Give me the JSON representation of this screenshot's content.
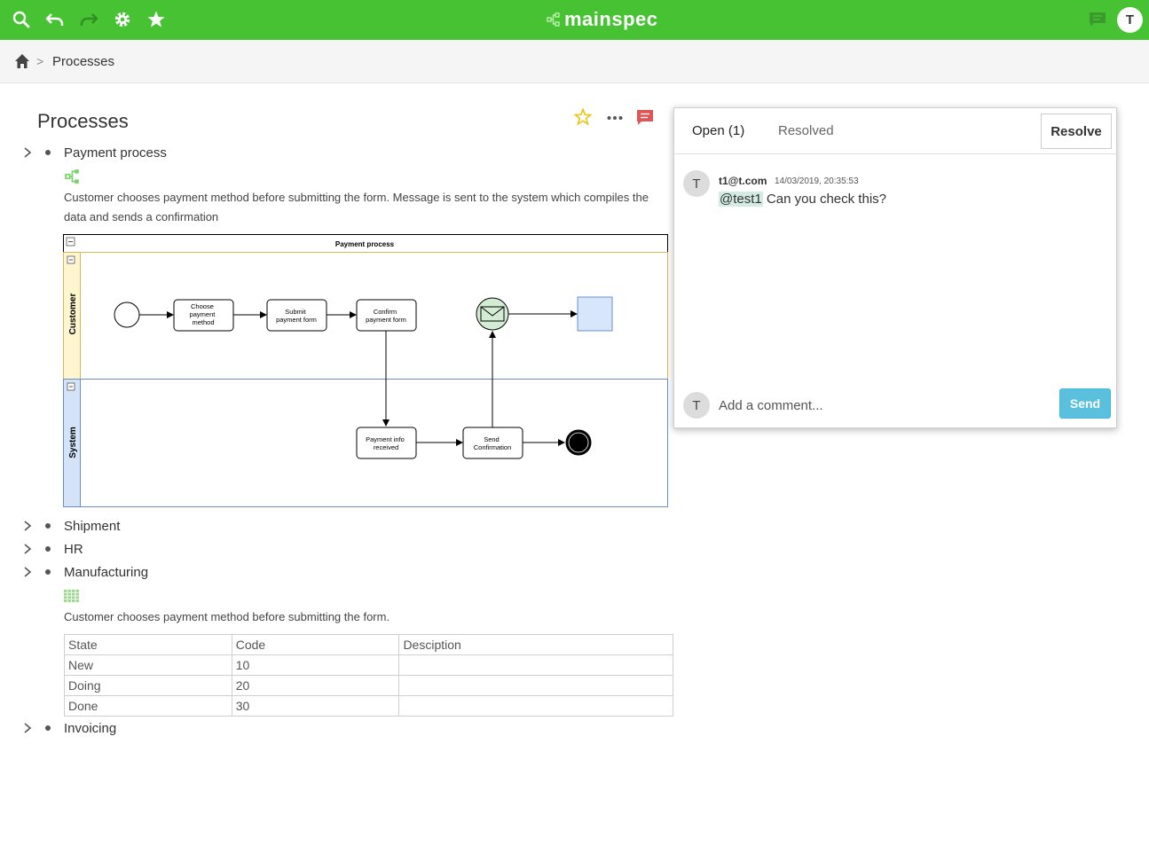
{
  "app": {
    "name": "mainspec",
    "user_initial": "T"
  },
  "topbar": {
    "icons": [
      "search-icon",
      "undo-icon",
      "redo-icon",
      "gear-icon",
      "star-icon"
    ],
    "right_icons": [
      "chat-icon"
    ]
  },
  "breadcrumb": {
    "current": "Processes",
    "separator": ">"
  },
  "page": {
    "title": "Processes"
  },
  "tree": {
    "items": [
      {
        "label": "Payment process",
        "description": "Customer chooses payment method before submitting the form. Message is sent to the system which compiles the data and sends a confirmation"
      },
      {
        "label": "Shipment"
      },
      {
        "label": "HR"
      },
      {
        "label": "Manufacturing",
        "description": "Customer chooses payment method before submitting the form."
      },
      {
        "label": "Invoicing"
      }
    ]
  },
  "diagram": {
    "title": "Payment process",
    "lanes": [
      "Customer",
      "System"
    ],
    "tasks": {
      "choose": [
        "Choose",
        "payment",
        "method"
      ],
      "submit": [
        "Submit",
        "payment form"
      ],
      "confirm": [
        "Confirm",
        "payment form"
      ],
      "received": [
        "Payment info",
        "received"
      ],
      "send": [
        "Send",
        "Confirmation"
      ]
    }
  },
  "table": {
    "headers": [
      "State",
      "Code",
      "Desciption"
    ],
    "rows": [
      [
        "New",
        "10",
        ""
      ],
      [
        "Doing",
        "20",
        ""
      ],
      [
        "Done",
        "30",
        ""
      ]
    ]
  },
  "comments": {
    "tabs": {
      "open": "Open (1)",
      "resolved": "Resolved"
    },
    "resolve_label": "Resolve",
    "items": [
      {
        "initial": "T",
        "user": "t1@t.com",
        "time": "14/03/2019, 20:35:53",
        "mention": "@test1",
        "text": " Can you check this?"
      }
    ],
    "input_initial": "T",
    "input_placeholder": "Add a comment...",
    "send_label": "Send"
  },
  "colors": {
    "brand": "#47c232",
    "send": "#5bc0de",
    "comment_flag": "#e05555",
    "star": "#e6c619"
  }
}
